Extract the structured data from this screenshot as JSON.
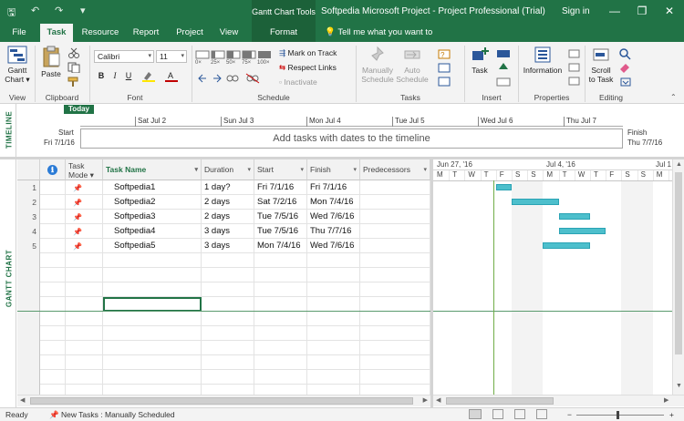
{
  "titlebar": {
    "context_tab": "Gantt Chart Tools",
    "title": "Softpedia Microsoft Project - Project Professional (Trial)",
    "signin": "Sign in",
    "min": "—",
    "restore": "❐",
    "close": "✕",
    "save_glyph": "🖫",
    "undo_glyph": "↶",
    "redo_glyph": "↷",
    "custom_glyph": "▾"
  },
  "tabs": [
    "File",
    "Task",
    "Resource",
    "Report",
    "Project",
    "View",
    "Format"
  ],
  "tellme": "Tell me what you want to do",
  "ribbon": {
    "view_group": {
      "label": "View",
      "gantt_btn": "Gantt\nChart ▾"
    },
    "clipboard": {
      "label": "Clipboard",
      "paste": "Paste"
    },
    "font": {
      "label": "Font",
      "family": "Calibri",
      "size": "11",
      "bold": "B",
      "italic": "I",
      "underline": "U"
    },
    "schedule": {
      "label": "Schedule",
      "mark": "Mark on Track",
      "respect": "Respect Links",
      "inactivate": "Inactivate",
      "pct": [
        "0×",
        "25×",
        "50×",
        "75×",
        "100×"
      ]
    },
    "tasks": {
      "label": "Tasks",
      "manual": "Manually\nSchedule",
      "auto": "Auto\nSchedule"
    },
    "insert": {
      "label": "Insert",
      "task": "Task"
    },
    "properties": {
      "label": "Properties",
      "information": "Information"
    },
    "editing": {
      "label": "Editing",
      "scroll": "Scroll\nto Task"
    }
  },
  "timeline": {
    "side_label": "TIMELINE",
    "today": "Today",
    "start_label": "Start",
    "start_date": "Fri 7/1/16",
    "finish_label": "Finish",
    "finish_date": "Thu 7/7/16",
    "ticks": [
      "Sat Jul 2",
      "Sun Jul 3",
      "Mon Jul 4",
      "Tue Jul 5",
      "Wed Jul 6",
      "Thu Jul 7"
    ],
    "placeholder": "Add tasks with dates to the timeline"
  },
  "gantt": {
    "side_label": "GANTT CHART",
    "columns": {
      "info": "ℹ",
      "mode": "Task\nMode ▾",
      "name": "Task Name",
      "duration": "Duration",
      "start": "Start",
      "finish": "Finish",
      "pred": "Predecessors"
    },
    "rows": [
      {
        "id": "1",
        "name": "Softpedia1",
        "duration": "1 day?",
        "start": "Fri 7/1/16",
        "finish": "Fri 7/1/16"
      },
      {
        "id": "2",
        "name": "Softpedia2",
        "duration": "2 days",
        "start": "Sat 7/2/16",
        "finish": "Mon 7/4/16"
      },
      {
        "id": "3",
        "name": "Softpedia3",
        "duration": "2 days",
        "start": "Tue 7/5/16",
        "finish": "Wed 7/6/16"
      },
      {
        "id": "4",
        "name": "Softpedia4",
        "duration": "3 days",
        "start": "Tue 7/5/16",
        "finish": "Thu 7/7/16"
      },
      {
        "id": "5",
        "name": "Softpedia5",
        "duration": "3 days",
        "start": "Mon 7/4/16",
        "finish": "Wed 7/6/16"
      }
    ],
    "chart": {
      "weeks": [
        "Jun 27, '16",
        "Jul 4, '16",
        "Jul 1"
      ],
      "days": [
        "M",
        "T",
        "W",
        "T",
        "F",
        "S",
        "S",
        "M",
        "T",
        "W",
        "T",
        "F",
        "S",
        "S",
        "M"
      ]
    }
  },
  "status": {
    "ready": "Ready",
    "new_tasks": "New Tasks : Manually Scheduled",
    "zoom_minus": "−",
    "zoom_plus": "+"
  },
  "colors": {
    "brand": "#217346",
    "bar": "#4dbfcc"
  }
}
